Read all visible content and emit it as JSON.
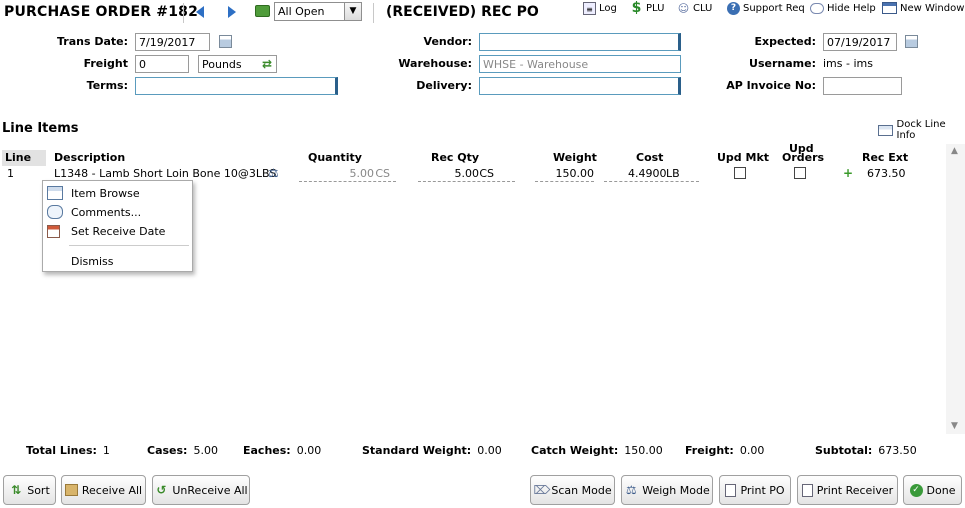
{
  "header": {
    "title": "PURCHASE ORDER #182",
    "filter_value": "All Open",
    "subtitle": "(RECEIVED) REC PO"
  },
  "toolbar": {
    "log": "Log",
    "plu": "PLU",
    "clu": "CLU",
    "support": "Support Req",
    "hide_help": "Hide Help",
    "new_window": "New Window"
  },
  "form": {
    "trans_date_label": "Trans Date:",
    "trans_date": "7/19/2017",
    "freight_label": "Freight",
    "freight_value": "0",
    "freight_unit": "Pounds",
    "terms_label": "Terms:",
    "terms_value": "",
    "vendor_label": "Vendor:",
    "vendor_value": "",
    "warehouse_label": "Warehouse:",
    "warehouse_value": "WHSE - Warehouse",
    "delivery_label": "Delivery:",
    "delivery_value": "",
    "expected_label": "Expected:",
    "expected_value": "07/19/2017",
    "username_label": "Username:",
    "username_value": "ims - ims",
    "ap_invoice_label": "AP Invoice No:",
    "ap_invoice_value": ""
  },
  "line_items": {
    "title": "Line Items",
    "dock_label": "Dock Line Info",
    "columns": {
      "line": "Line",
      "description": "Description",
      "quantity": "Quantity",
      "rec_qty": "Rec Qty",
      "weight": "Weight",
      "cost": "Cost",
      "upd_mkt": "Upd Mkt",
      "upd_orders_1": "Upd",
      "upd_orders_2": "Orders",
      "rec_ext": "Rec Ext"
    },
    "rows": [
      {
        "line": "1",
        "description": "L1348 - Lamb Short Loin Bone 10@3LBS",
        "quantity": "5.00",
        "quantity_unit": "CS",
        "rec_qty": "5.00",
        "rec_qty_unit": "CS",
        "weight": "150.00",
        "cost": "4.4900",
        "cost_unit": "LB",
        "rec_ext": "673.50"
      }
    ]
  },
  "context_menu": {
    "item_browse": "Item Browse",
    "comments": "Comments...",
    "set_receive_date": "Set Receive Date",
    "dismiss": "Dismiss"
  },
  "totals": {
    "total_lines_label": "Total Lines:",
    "total_lines": "1",
    "cases_label": "Cases:",
    "cases": "5.00",
    "eaches_label": "Eaches:",
    "eaches": "0.00",
    "std_weight_label": "Standard Weight:",
    "std_weight": "0.00",
    "catch_weight_label": "Catch Weight:",
    "catch_weight": "150.00",
    "freight_label": "Freight:",
    "freight": "0.00",
    "subtotal_label": "Subtotal:",
    "subtotal": "673.50"
  },
  "buttons": {
    "sort": "Sort",
    "receive_all": "Receive All",
    "unreceive_all": "UnReceive All",
    "scan_mode": "Scan Mode",
    "weigh_mode": "Weigh Mode",
    "print_po": "Print PO",
    "print_receiver": "Print Receiver",
    "done": "Done"
  },
  "colors": {
    "accent_blue": "#2d6fc4",
    "field_border": "#5a9bbd",
    "green": "#3a8a2a"
  }
}
